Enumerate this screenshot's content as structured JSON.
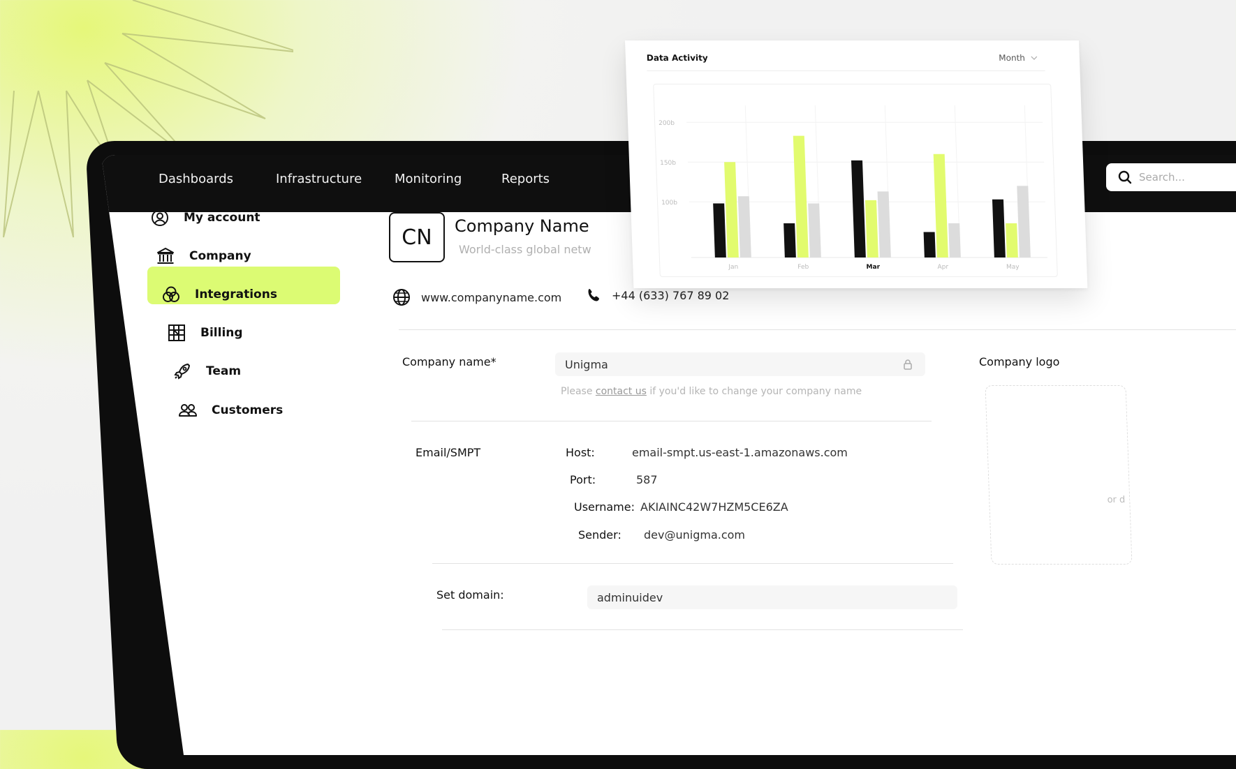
{
  "nav": {
    "items": [
      "Dashboards",
      "Infrastructure",
      "Monitoring",
      "Reports"
    ],
    "search_placeholder": "Search..."
  },
  "sidebar": {
    "items": [
      {
        "label": "My account",
        "icon": "user-circle-icon"
      },
      {
        "label": "Company",
        "icon": "bank-icon",
        "active": true
      },
      {
        "label": "Integrations",
        "icon": "integrations-icon"
      },
      {
        "label": "Billing",
        "icon": "billing-icon"
      },
      {
        "label": "Team",
        "icon": "rocket-icon"
      },
      {
        "label": "Customers",
        "icon": "users-icon"
      }
    ]
  },
  "company": {
    "initials": "CN",
    "name": "Company Name",
    "tagline": "World-class global netw",
    "website": "www.companyname.com",
    "phone": "+44 (633) 767 89 02"
  },
  "form": {
    "company_name_label": "Company name*",
    "company_name_value": "Unigma",
    "hint_prefix": "Please ",
    "hint_link": "contact us",
    "hint_suffix": " if you'd like to change  your company name",
    "email_section_label": "Email/SMPT",
    "host_label": "Host:",
    "host_value": "email-smpt.us-east-1.amazonaws.com",
    "port_label": "Port:",
    "port_value": "587",
    "username_label": "Username:",
    "username_value": "AKIAINC42W7HZM5CE6ZA",
    "sender_label": "Sender:",
    "sender_value": "dev@unigma.com",
    "domain_label": "Set domain:",
    "domain_value": "adminuidev",
    "logo_label": "Company logo",
    "logo_drop_hint": "or d"
  },
  "card": {
    "title": "Data Activity",
    "period": "Month"
  },
  "chart_data": {
    "type": "bar",
    "title": "Data Activity",
    "categories": [
      "Jan",
      "Feb",
      "Mar",
      "Apr",
      "May"
    ],
    "highlighted_category": "Mar",
    "yticks": [
      "100b",
      "150b",
      "200b"
    ],
    "ytick_values": [
      100,
      150,
      200
    ],
    "ylim": [
      30,
      230
    ],
    "grid": true,
    "series": [
      {
        "color": "#111111",
        "values": [
          98,
          73,
          152,
          62,
          103
        ]
      },
      {
        "color": "#e2fb6e",
        "values": [
          150,
          183,
          102,
          160,
          73
        ]
      },
      {
        "color": "#dcdcdc",
        "values": [
          107,
          98,
          113,
          73,
          120
        ]
      }
    ]
  },
  "colors": {
    "accent": "#dcfb73",
    "dark": "#0f0f0f"
  }
}
